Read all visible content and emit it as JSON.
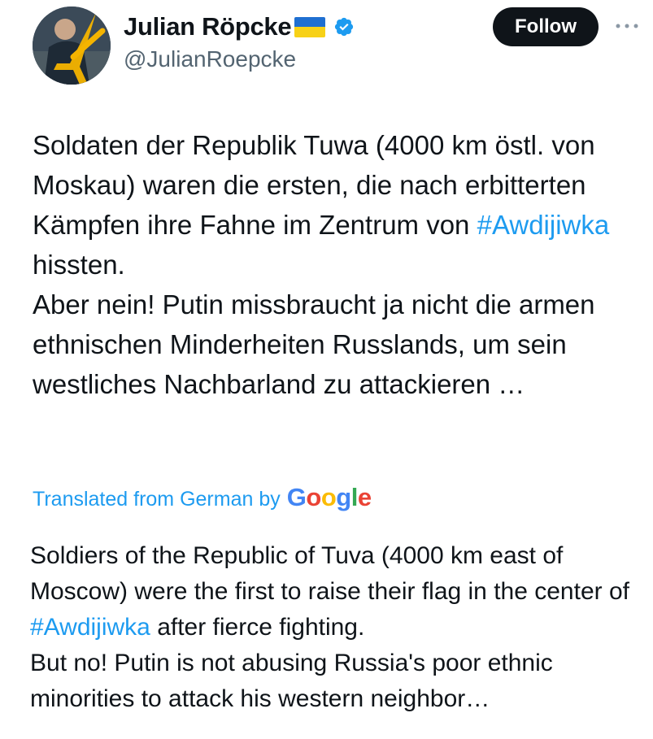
{
  "author": {
    "name": "Julian Röpcke",
    "handle": "@JulianRoepcke",
    "flag_icon": "ukraine-flag",
    "verified_icon": "verified-badge"
  },
  "actions": {
    "follow_label": "Follow",
    "more_icon": "more-horizontal"
  },
  "tweet": {
    "original": {
      "p1_a": "Soldaten der Republik Tuwa (4000 km östl. von Moskau) waren die ersten, die nach erbitterten Kämpfen ihre Fahne im Zentrum von ",
      "p1_hashtag": "#Awdijiwka",
      "p1_b": " hissten.",
      "p2": "Aber nein! Putin missbraucht ja nicht die armen ethnischen Minderheiten Russlands, um sein westliches Nachbarland zu attackieren …"
    },
    "translation": {
      "label": "Translated from German by",
      "provider": "Google",
      "p1_a": "Soldiers of the Republic of Tuva (4000 km east of Moscow) were the first to raise their flag in the center of ",
      "p1_hashtag": "#Awdijiwka",
      "p1_b": " after fierce fighting.",
      "p2": "But no! Putin is not abusing Russia's poor ethnic minorities to attack his western neighbor…"
    }
  },
  "colors": {
    "accent": "#1d9bf0",
    "text": "#0f1419",
    "secondary": "#536471",
    "follow_bg": "#0f1419"
  }
}
